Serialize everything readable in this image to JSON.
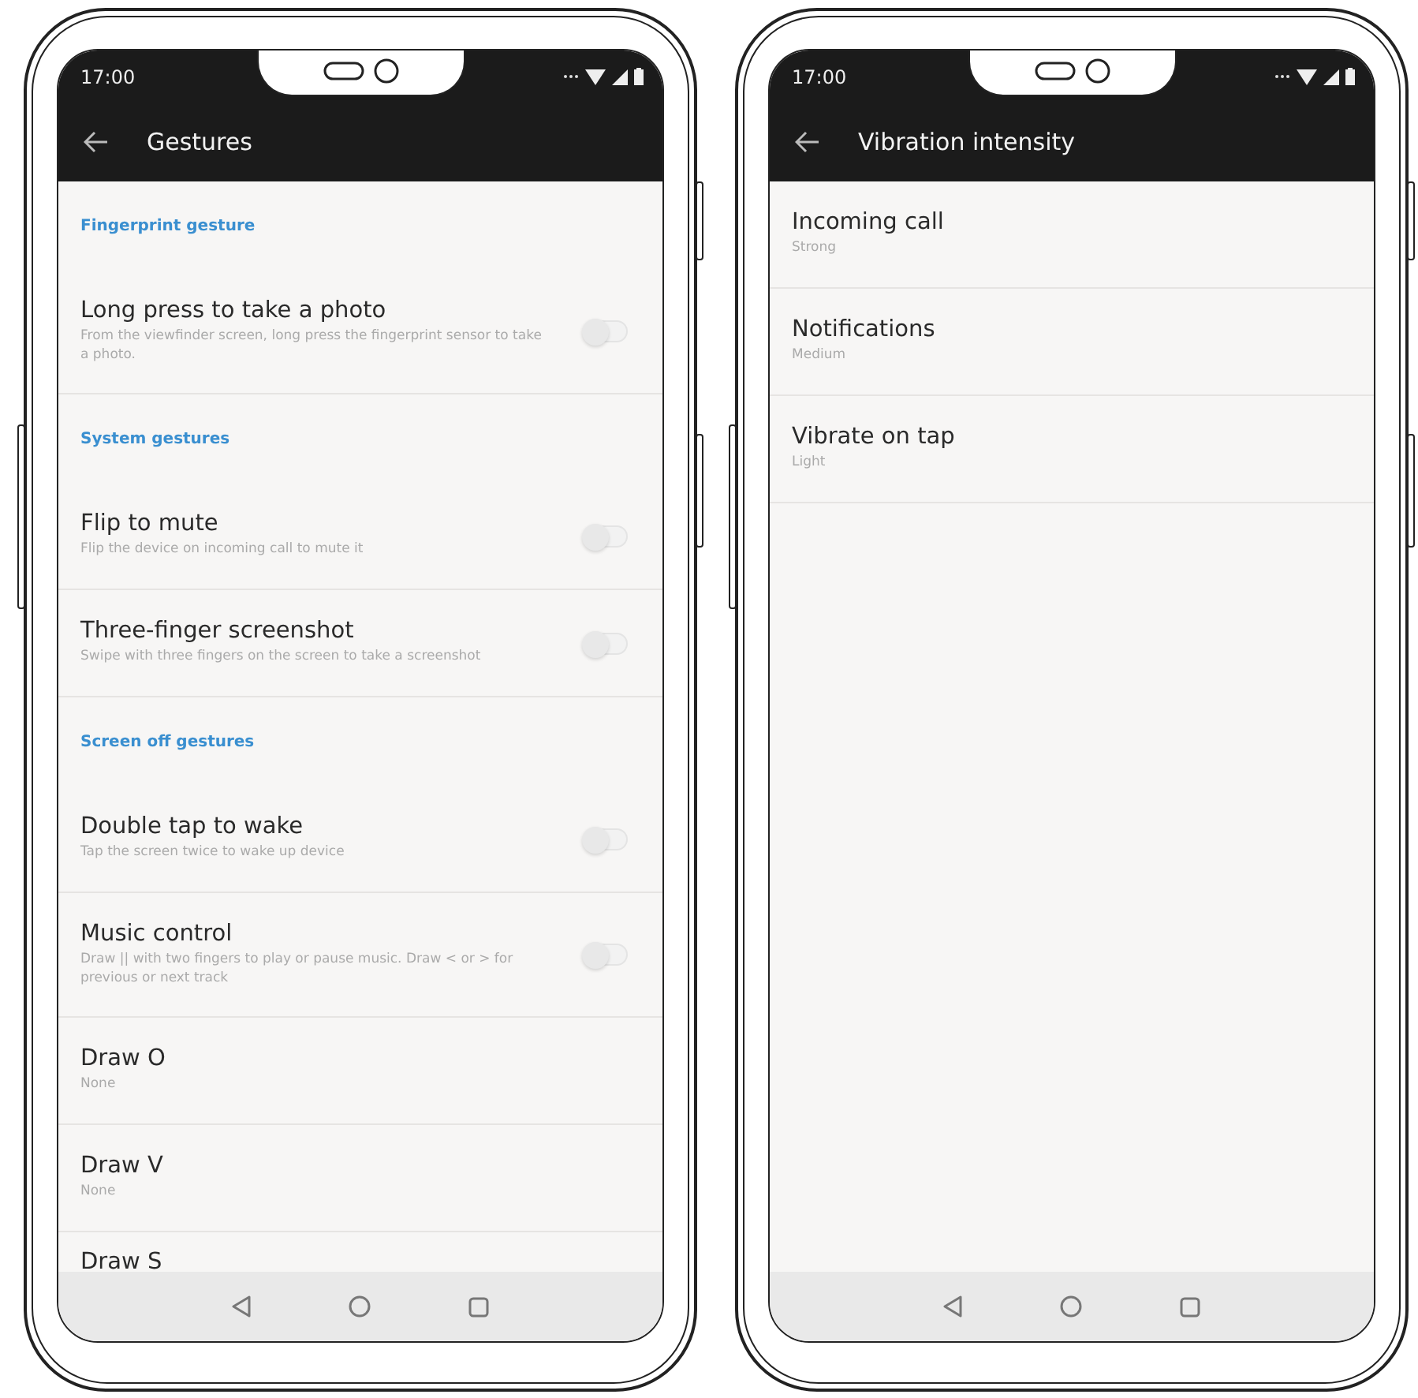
{
  "phones": [
    {
      "status_bar": {
        "time": "17:00"
      },
      "app_bar": {
        "title": "Gestures"
      },
      "items": [
        {
          "kind": "header",
          "title": "Fingerprint gesture"
        },
        {
          "kind": "switch",
          "title": "Long press to take a photo",
          "summary": "From the viewfinder screen, long press the fingerprint sensor to take a photo.",
          "on": false
        },
        {
          "kind": "header",
          "title": "System gestures"
        },
        {
          "kind": "switch",
          "title": "Flip to mute",
          "summary": "Flip the device on incoming call to mute it",
          "on": false
        },
        {
          "kind": "switch",
          "title": "Three-finger screenshot",
          "summary": "Swipe with three fingers on the screen to take a screenshot",
          "on": false
        },
        {
          "kind": "header",
          "title": "Screen off gestures"
        },
        {
          "kind": "switch",
          "title": "Double tap to wake",
          "summary": "Tap the screen twice to wake up device",
          "on": false
        },
        {
          "kind": "switch",
          "title": "Music control",
          "summary": "Draw || with two fingers to play or pause music. Draw < or > for previous or next track",
          "on": false
        },
        {
          "kind": "value",
          "title": "Draw O",
          "summary": "None"
        },
        {
          "kind": "value",
          "title": "Draw V",
          "summary": "None"
        },
        {
          "kind": "value",
          "title": "Draw S"
        }
      ]
    },
    {
      "status_bar": {
        "time": "17:00"
      },
      "app_bar": {
        "title": "Vibration intensity"
      },
      "items": [
        {
          "kind": "value",
          "title": "Incoming call",
          "summary": "Strong"
        },
        {
          "kind": "value",
          "title": "Notifications",
          "summary": "Medium"
        },
        {
          "kind": "value",
          "title": "Vibrate on tap",
          "summary": "Light"
        }
      ]
    }
  ]
}
